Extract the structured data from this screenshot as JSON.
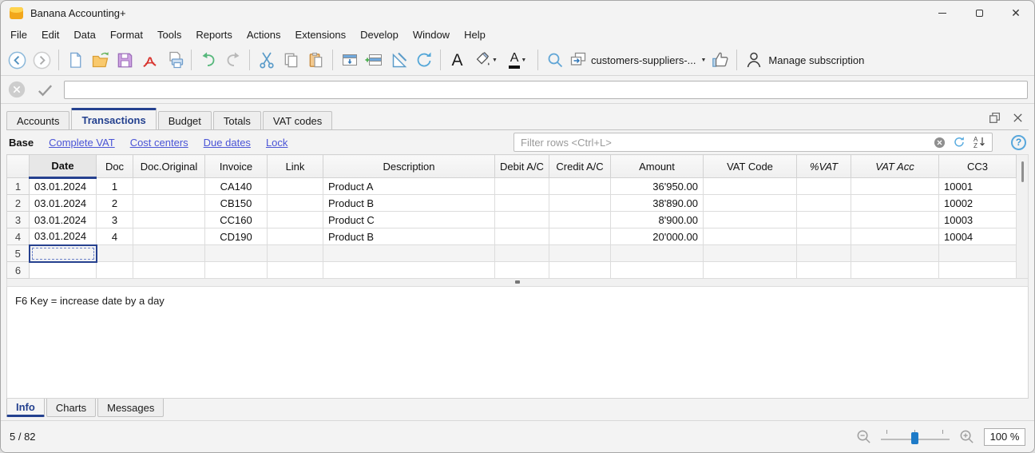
{
  "window": {
    "title": "Banana Accounting+"
  },
  "menu": {
    "items": [
      "File",
      "Edit",
      "Data",
      "Format",
      "Tools",
      "Reports",
      "Actions",
      "Extensions",
      "Develop",
      "Window",
      "Help"
    ]
  },
  "toolbar": {
    "font_letter": "A",
    "font_color_letter": "A",
    "file_selector_label": "customers-suppliers-...",
    "file_selector_caret": "▼",
    "manage_subscription_label": "Manage subscription"
  },
  "formula_bar": {
    "value": ""
  },
  "doc_tabs": {
    "tabs": [
      {
        "label": "Accounts",
        "active": false
      },
      {
        "label": "Transactions",
        "active": true
      },
      {
        "label": "Budget",
        "active": false
      },
      {
        "label": "Totals",
        "active": false
      },
      {
        "label": "VAT codes",
        "active": false
      }
    ]
  },
  "views_bar": {
    "views": [
      {
        "label": "Base",
        "active": true
      },
      {
        "label": "Complete VAT",
        "active": false
      },
      {
        "label": "Cost centers",
        "active": false
      },
      {
        "label": "Due dates",
        "active": false
      },
      {
        "label": "Lock",
        "active": false
      }
    ],
    "filter_placeholder": "Filter rows <Ctrl+L>",
    "help_glyph": "?"
  },
  "table": {
    "columns": [
      "Date",
      "Doc",
      "Doc.Original",
      "Invoice",
      "Link",
      "Description",
      "Debit A/C",
      "Credit A/C",
      "Amount",
      "VAT Code",
      "%VAT",
      "VAT Acc",
      "CC3"
    ],
    "selected_column": "Date",
    "rows": [
      {
        "num": "1",
        "cells": [
          "03.01.2024",
          "1",
          "",
          "CA140",
          "",
          "Product A",
          "",
          "",
          "36'950.00",
          "",
          "",
          "",
          "10001"
        ]
      },
      {
        "num": "2",
        "cells": [
          "03.01.2024",
          "2",
          "",
          "CB150",
          "",
          "Product B",
          "",
          "",
          "38'890.00",
          "",
          "",
          "",
          "10002"
        ]
      },
      {
        "num": "3",
        "cells": [
          "03.01.2024",
          "3",
          "",
          "CC160",
          "",
          "Product C",
          "",
          "",
          "8'900.00",
          "",
          "",
          "",
          "10003"
        ]
      },
      {
        "num": "4",
        "cells": [
          "03.01.2024",
          "4",
          "",
          "CD190",
          "",
          "Product B",
          "",
          "",
          "20'000.00",
          "",
          "",
          "",
          "10004"
        ]
      },
      {
        "num": "5",
        "cells": [
          "",
          "",
          "",
          "",
          "",
          "",
          "",
          "",
          "",
          "",
          "",
          "",
          ""
        ],
        "current": true
      },
      {
        "num": "6",
        "cells": [
          "",
          "",
          "",
          "",
          "",
          "",
          "",
          "",
          "",
          "",
          "",
          "",
          ""
        ]
      }
    ]
  },
  "info_panel": {
    "text": "F6 Key = increase date by a day"
  },
  "bottom_tabs": {
    "tabs": [
      {
        "label": "Info",
        "active": true
      },
      {
        "label": "Charts",
        "active": false
      },
      {
        "label": "Messages",
        "active": false
      }
    ]
  },
  "status_bar": {
    "position": "5 / 82",
    "zoom_value": "100 %"
  },
  "colors": {
    "accent_blue": "#24418f",
    "link_blue": "#4a54d6",
    "slider_handle": "#1e7bc8"
  }
}
